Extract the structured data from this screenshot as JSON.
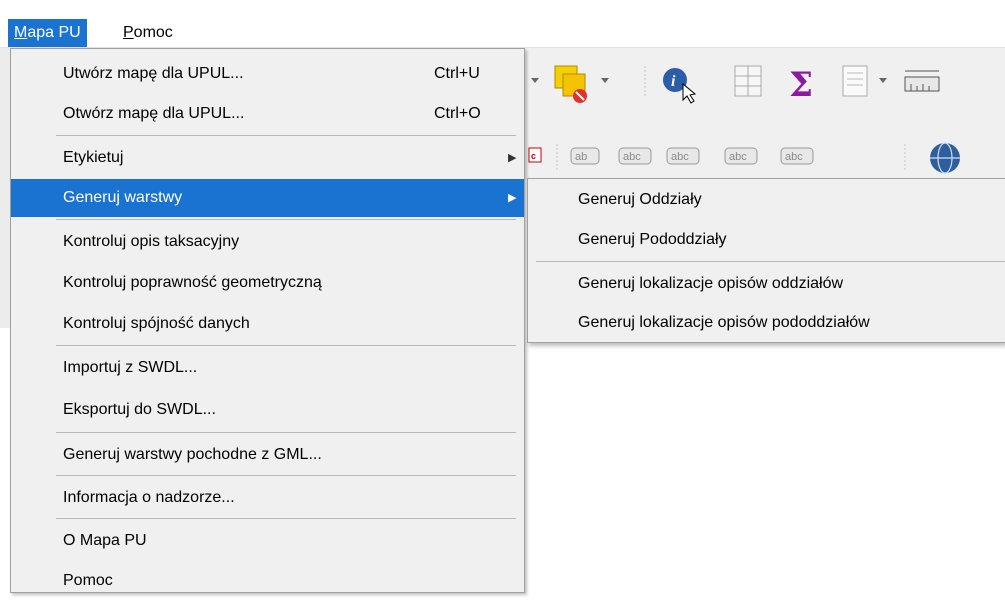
{
  "menubar": {
    "items": [
      {
        "label_pre": "",
        "mnemonic": "M",
        "label_post": "apa PU",
        "active": true
      },
      {
        "label_pre": "",
        "mnemonic": "P",
        "label_post": "omoc",
        "active": false
      }
    ]
  },
  "menu": {
    "items": [
      {
        "label": "Utwórz mapę dla UPUL...",
        "shortcut": "Ctrl+U"
      },
      {
        "label": "Otwórz mapę dla UPUL...",
        "shortcut": "Ctrl+O"
      },
      {
        "label": "Etykietuj"
      },
      {
        "label": "Generuj warstwy"
      },
      {
        "label": "Kontroluj opis taksacyjny"
      },
      {
        "label": "Kontroluj poprawność geometryczną"
      },
      {
        "label": "Kontroluj spójność danych"
      },
      {
        "label": "Importuj z SWDL..."
      },
      {
        "label": "Eksportuj do SWDL..."
      },
      {
        "label": "Generuj warstwy pochodne z GML..."
      },
      {
        "label": "Informacja o nadzorze..."
      },
      {
        "label": "O Mapa PU"
      },
      {
        "label": "Pomoc"
      }
    ]
  },
  "submenu": {
    "items": [
      {
        "label": "Generuj Oddziały"
      },
      {
        "label": "Generuj Pododdziały"
      },
      {
        "label": "Generuj lokalizacje opisów oddziałów"
      },
      {
        "label": "Generuj lokalizacje opisów pododdziałów"
      }
    ]
  },
  "toolbar": {
    "row1_icons": [
      "selection-icon",
      "deselect-icon",
      "identify-icon",
      "attribute-table-icon",
      "statistics-sigma-icon",
      "field-calculator-icon",
      "measure-icon"
    ],
    "row2_icons": [
      "label-icon",
      "label-pin-icon",
      "label-move-icon",
      "label-rotate-icon",
      "label-change-icon",
      "label-show-icon",
      "globe-icon"
    ],
    "sigma_glyph": "Σ",
    "abc_text": "abc",
    "ab_text": "ab"
  },
  "colors": {
    "highlight": "#1a73d1",
    "menu_bg": "#f0f0f0"
  }
}
